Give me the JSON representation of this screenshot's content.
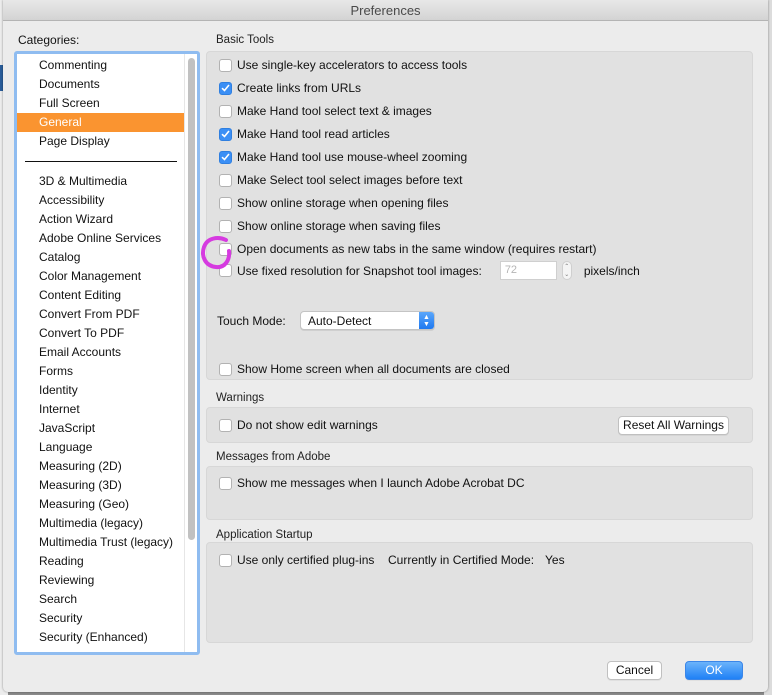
{
  "window": {
    "title": "Preferences"
  },
  "categories": {
    "label": "Categories:",
    "primary": [
      {
        "label": "Commenting",
        "selected": false
      },
      {
        "label": "Documents",
        "selected": false
      },
      {
        "label": "Full Screen",
        "selected": false
      },
      {
        "label": "General",
        "selected": true
      },
      {
        "label": "Page Display",
        "selected": false
      }
    ],
    "secondary": [
      {
        "label": "3D & Multimedia"
      },
      {
        "label": "Accessibility"
      },
      {
        "label": "Action Wizard"
      },
      {
        "label": "Adobe Online Services"
      },
      {
        "label": "Catalog"
      },
      {
        "label": "Color Management"
      },
      {
        "label": "Content Editing"
      },
      {
        "label": "Convert From PDF"
      },
      {
        "label": "Convert To PDF"
      },
      {
        "label": "Email Accounts"
      },
      {
        "label": "Forms"
      },
      {
        "label": "Identity"
      },
      {
        "label": "Internet"
      },
      {
        "label": "JavaScript"
      },
      {
        "label": "Language"
      },
      {
        "label": "Measuring (2D)"
      },
      {
        "label": "Measuring (3D)"
      },
      {
        "label": "Measuring (Geo)"
      },
      {
        "label": "Multimedia (legacy)"
      },
      {
        "label": "Multimedia Trust (legacy)"
      },
      {
        "label": "Reading"
      },
      {
        "label": "Reviewing"
      },
      {
        "label": "Search"
      },
      {
        "label": "Security"
      },
      {
        "label": "Security (Enhanced)"
      }
    ]
  },
  "basic_tools": {
    "title": "Basic Tools",
    "options": [
      {
        "label": "Use single-key accelerators to access tools",
        "checked": false
      },
      {
        "label": "Create links from URLs",
        "checked": true
      },
      {
        "label": "Make Hand tool select text & images",
        "checked": false
      },
      {
        "label": "Make Hand tool read articles",
        "checked": true
      },
      {
        "label": "Make Hand tool use mouse-wheel zooming",
        "checked": true
      },
      {
        "label": "Make Select tool select images before text",
        "checked": false
      },
      {
        "label": "Show online storage when opening files",
        "checked": false
      },
      {
        "label": "Show online storage when saving files",
        "checked": false
      },
      {
        "label": "Open documents as new tabs in the same window (requires restart)",
        "checked": false
      }
    ],
    "snapshot": {
      "label": "Use fixed resolution for Snapshot tool images:",
      "checked": false,
      "value": "72",
      "unit": "pixels/inch"
    },
    "touch_mode": {
      "label": "Touch Mode:",
      "value": "Auto-Detect"
    },
    "home_screen": {
      "label": "Show Home screen when all documents are closed",
      "checked": false
    }
  },
  "warnings": {
    "title": "Warnings",
    "option": {
      "label": "Do not show edit warnings",
      "checked": false
    },
    "reset_button": "Reset All Warnings"
  },
  "messages": {
    "title": "Messages from Adobe",
    "option": {
      "label": "Show me messages when I launch Adobe Acrobat DC",
      "checked": false
    }
  },
  "startup": {
    "title": "Application Startup",
    "option": {
      "label": "Use only certified plug-ins",
      "checked": false
    },
    "mode_label": "Currently in Certified Mode:",
    "mode_value": "Yes"
  },
  "footer": {
    "cancel": "Cancel",
    "ok": "OK"
  },
  "annotation": {
    "color": "#d63ae0"
  }
}
